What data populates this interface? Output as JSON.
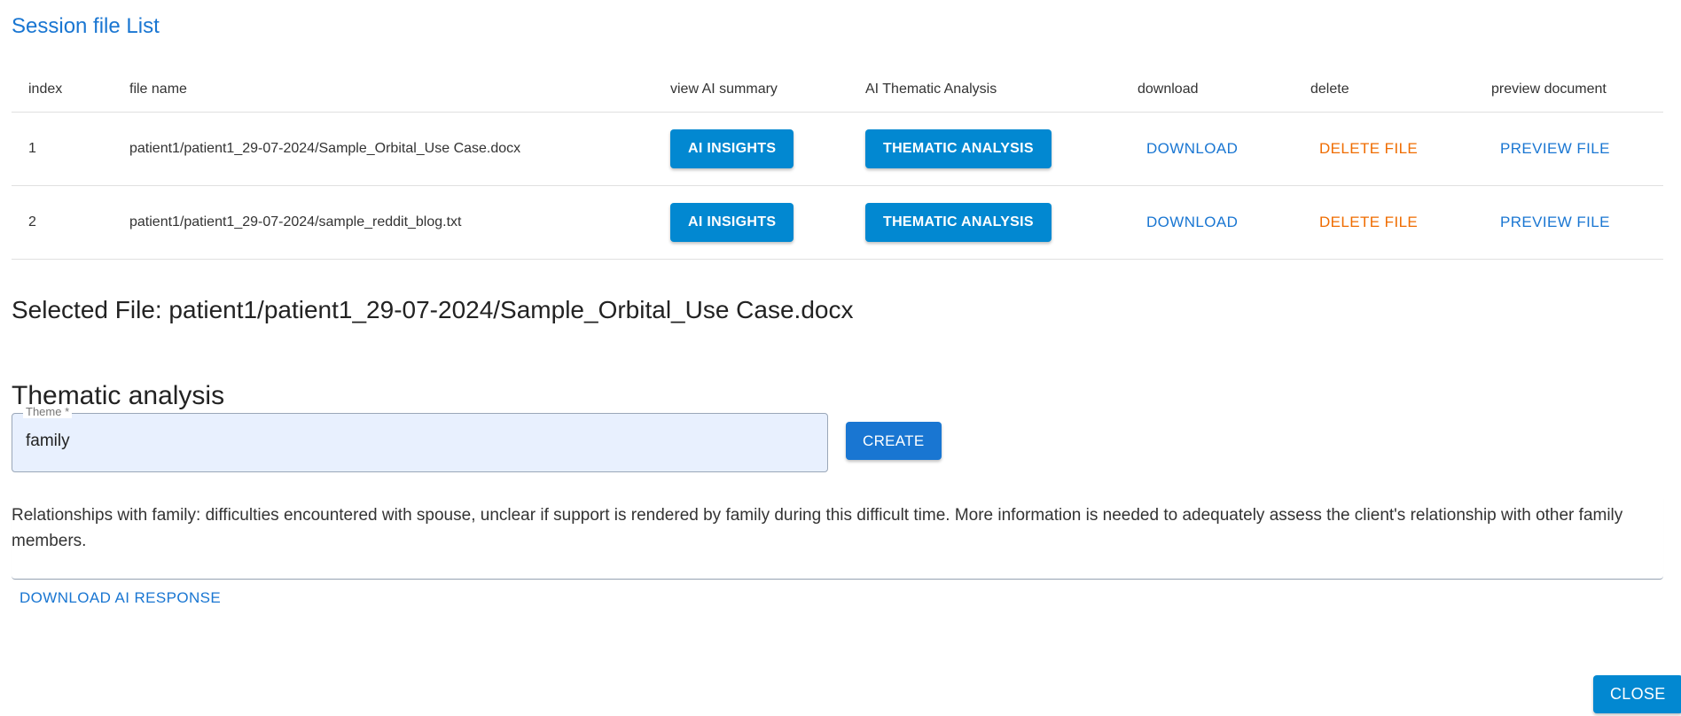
{
  "list_title": "Session file List",
  "table": {
    "headers": {
      "index": "index",
      "file_name": "file name",
      "view_ai_summary": "view AI summary",
      "ai_thematic": "AI Thematic Analysis",
      "download": "download",
      "delete": "delete",
      "preview": "preview document"
    },
    "rows": [
      {
        "index": "1",
        "file_name": "patient1/patient1_29-07-2024/Sample_Orbital_Use Case.docx",
        "insights_label": "AI INSIGHTS",
        "thematic_label": "THEMATIC ANALYSIS",
        "download_label": "DOWNLOAD",
        "delete_label": "DELETE FILE",
        "preview_label": "PREVIEW FILE"
      },
      {
        "index": "2",
        "file_name": "patient1/patient1_29-07-2024/sample_reddit_blog.txt",
        "insights_label": "AI INSIGHTS",
        "thematic_label": "THEMATIC ANALYSIS",
        "download_label": "DOWNLOAD",
        "delete_label": "DELETE FILE",
        "preview_label": "PREVIEW FILE"
      }
    ]
  },
  "selected_file": "Selected File: patient1/patient1_29-07-2024/Sample_Orbital_Use Case.docx",
  "thematic": {
    "title": "Thematic analysis",
    "theme_label": "Theme *",
    "theme_value": "family",
    "create_label": "CREATE",
    "response": "Relationships with family: difficulties encountered with spouse, unclear if support is rendered by family during this difficult time. More information is needed to adequately assess the client's relationship with other family members.",
    "download_response_label": "DOWNLOAD AI RESPONSE"
  },
  "close_label": "CLOSE",
  "colors": {
    "primary": "#1976d2",
    "info": "#0288d1",
    "warning": "#ef6c00"
  }
}
